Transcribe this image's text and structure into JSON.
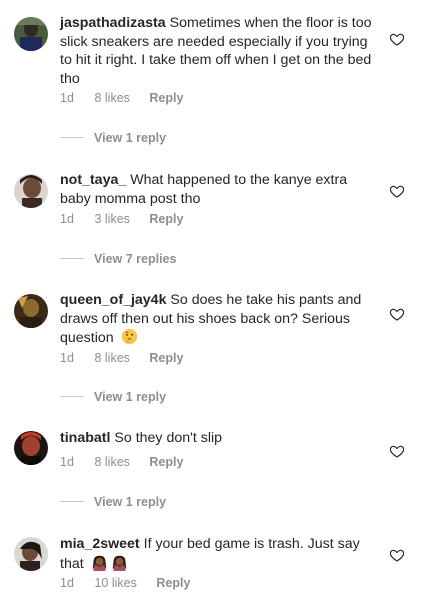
{
  "comments": [
    {
      "username": "jaspathadizasta",
      "text": "Sometimes when the floor is too slick sneakers are needed especially if you trying to hit it right. I take them off when I get on the bed tho",
      "time": "1d",
      "likes": "8 likes",
      "reply": "Reply",
      "view_replies": "View 1 reply"
    },
    {
      "username": "not_taya_",
      "text": "What happened to the kanye extra baby momma post tho",
      "time": "1d",
      "likes": "3 likes",
      "reply": "Reply",
      "view_replies": "View 7 replies"
    },
    {
      "username": "queen_of_jay4k",
      "text": "So does he take his pants and draws off then out his shoes back on? Serious question",
      "emoji": "thinking-face",
      "time": "1d",
      "likes": "8 likes",
      "reply": "Reply",
      "view_replies": "View 1 reply"
    },
    {
      "username": "tinabatl",
      "text": "So they don't slip",
      "time": "1d",
      "likes": "8 likes",
      "reply": "Reply",
      "view_replies": "View 1 reply"
    },
    {
      "username": "mia_2sweet",
      "text": "If your bed game is trash. Just say that",
      "emoji": "woman-gesturing-no x2",
      "time": "1d",
      "likes": "10 likes",
      "reply": "Reply"
    }
  ],
  "icons": {
    "like": "heart-outline-icon",
    "thinking": "thinking-face-emoji",
    "gesture": "woman-gesturing-no-emoji"
  },
  "colors": {
    "text": "#262626",
    "secondary": "#8e8e8e",
    "divider": "#c7c7c7"
  }
}
